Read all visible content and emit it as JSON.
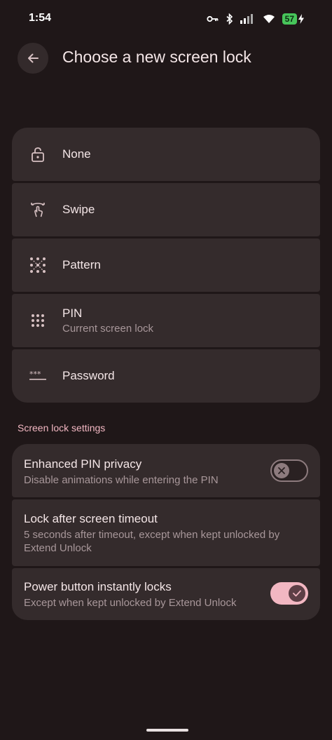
{
  "status_bar": {
    "time": "1:54",
    "battery": "57",
    "icons": [
      "key-icon",
      "bluetooth-icon",
      "signal-icon",
      "wifi-icon",
      "battery-icon",
      "charging-icon"
    ]
  },
  "header": {
    "back_icon": "arrow-left-icon",
    "title": "Choose a new screen lock"
  },
  "lock_options": [
    {
      "label": "None",
      "icon": "lock-open-icon"
    },
    {
      "label": "Swipe",
      "icon": "swipe-icon"
    },
    {
      "label": "Pattern",
      "icon": "pattern-icon"
    },
    {
      "label": "PIN",
      "subtitle": "Current screen lock",
      "icon": "pin-icon"
    },
    {
      "label": "Password",
      "icon": "password-icon"
    }
  ],
  "settings_section": {
    "header": "Screen lock settings",
    "items": [
      {
        "title": "Enhanced PIN privacy",
        "description": "Disable animations while entering the PIN",
        "toggle": "off"
      },
      {
        "title": "Lock after screen timeout",
        "description": "5 seconds after timeout, except when kept unlocked by Extend Unlock"
      },
      {
        "title": "Power button instantly locks",
        "description": "Except when kept unlocked by Extend Unlock",
        "toggle": "on"
      }
    ]
  },
  "colors": {
    "background": "#1f1718",
    "card": "#342b2c",
    "accent": "#f2b7c2",
    "text_primary": "#f4e6e7",
    "text_secondary": "#a8979a"
  }
}
